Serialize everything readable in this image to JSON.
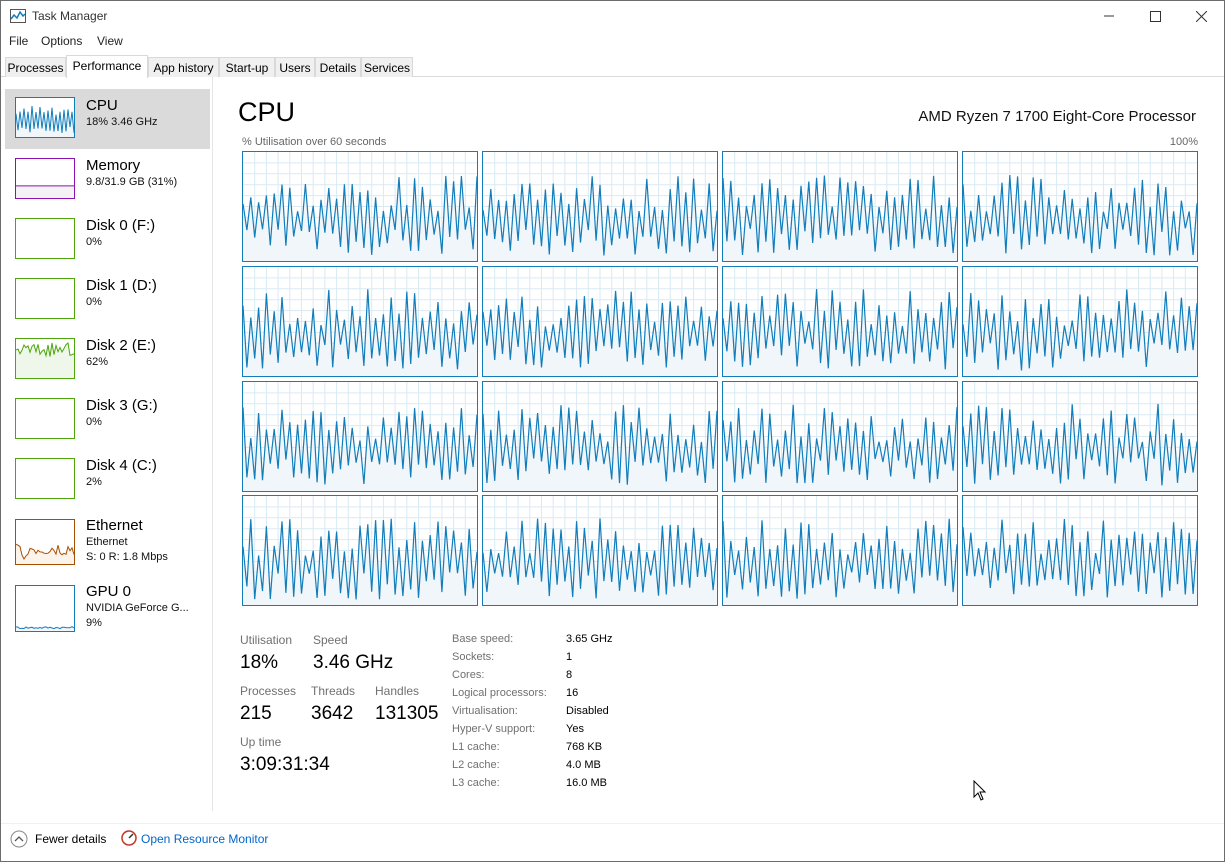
{
  "window": {
    "title": "Task Manager"
  },
  "menu": [
    "File",
    "Options",
    "View"
  ],
  "tabs": [
    "Processes",
    "Performance",
    "App history",
    "Start-up",
    "Users",
    "Details",
    "Services"
  ],
  "sidebar": [
    {
      "name": "CPU",
      "line1": "18% 3.46 GHz",
      "line2": "",
      "color": "#117dbb",
      "fill": "#f1f6fa"
    },
    {
      "name": "Memory",
      "line1": "9.8/31.9 GB (31%)",
      "line2": "",
      "color": "#8b12ae",
      "fill": "#f4f2f4"
    },
    {
      "name": "Disk 0 (F:)",
      "line1": "0%",
      "line2": "",
      "color": "#4da60c",
      "fill": "#eff7eb"
    },
    {
      "name": "Disk 1 (D:)",
      "line1": "0%",
      "line2": "",
      "color": "#4da60c",
      "fill": "#eff7eb"
    },
    {
      "name": "Disk 2 (E:)",
      "line1": "62%",
      "line2": "",
      "color": "#4da60c",
      "fill": "#eff7eb"
    },
    {
      "name": "Disk 3 (G:)",
      "line1": "0%",
      "line2": "",
      "color": "#4da60c",
      "fill": "#eff7eb"
    },
    {
      "name": "Disk 4 (C:)",
      "line1": "2%",
      "line2": "",
      "color": "#4da60c",
      "fill": "#eff7eb"
    },
    {
      "name": "Ethernet",
      "line1": "Ethernet",
      "line2": "S: 0 R: 1.8 Mbps",
      "color": "#a74f01",
      "fill": "#fcf3eb"
    },
    {
      "name": "GPU 0",
      "line1": "NVIDIA GeForce G...",
      "line2": "9%",
      "color": "#117dbb",
      "fill": "#f1f6fa"
    }
  ],
  "main": {
    "title": "CPU",
    "processor": "AMD Ryzen 7 1700 Eight-Core Processor",
    "axis_left": "% Utilisation over 60 seconds",
    "axis_right": "100%"
  },
  "stats": {
    "utilisation_label": "Utilisation",
    "utilisation": "18%",
    "speed_label": "Speed",
    "speed": "3.46 GHz",
    "processes_label": "Processes",
    "processes": "215",
    "threads_label": "Threads",
    "threads": "3642",
    "handles_label": "Handles",
    "handles": "131305",
    "uptime_label": "Up time",
    "uptime": "3:09:31:34"
  },
  "details": [
    {
      "label": "Base speed:",
      "value": "3.65 GHz"
    },
    {
      "label": "Sockets:",
      "value": "1"
    },
    {
      "label": "Cores:",
      "value": "8"
    },
    {
      "label": "Logical processors:",
      "value": "16"
    },
    {
      "label": "Virtualisation:",
      "value": "Disabled"
    },
    {
      "label": "Hyper-V support:",
      "value": "Yes"
    },
    {
      "label": "L1 cache:",
      "value": "768 KB"
    },
    {
      "label": "L2 cache:",
      "value": "4.0 MB"
    },
    {
      "label": "L3 cache:",
      "value": "16.0 MB"
    }
  ],
  "footer": {
    "fewer_details": "Fewer details",
    "resource_monitor": "Open Resource Monitor"
  },
  "colors": {
    "cpu_line": "#117dbb",
    "cpu_fill": "#f1f6fa",
    "grid": "#d9eaf4"
  }
}
